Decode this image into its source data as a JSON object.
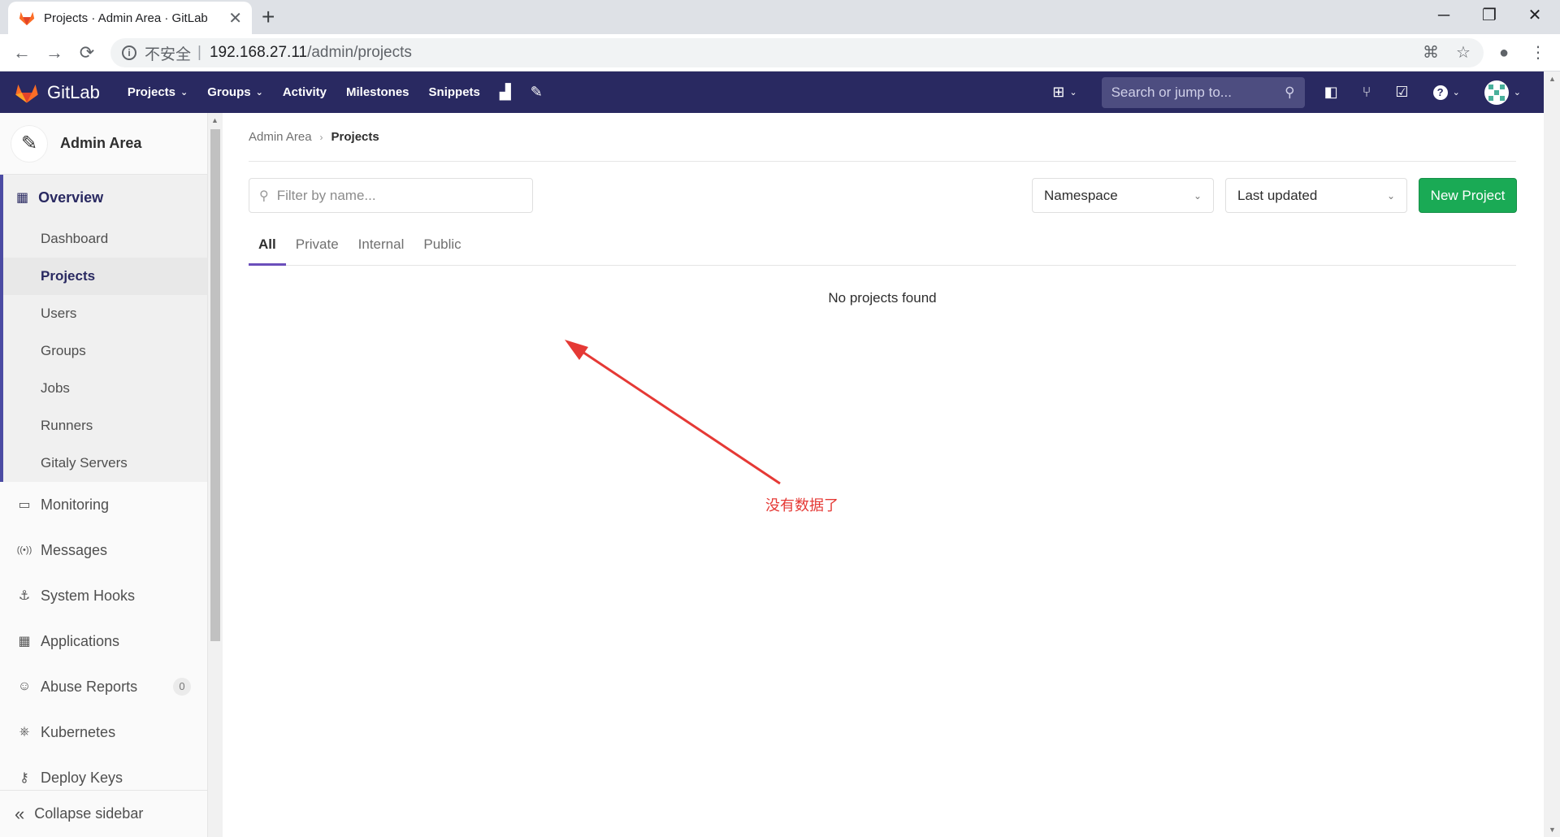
{
  "browser": {
    "tab_title": "Projects · Admin Area · GitLab",
    "tab_close": "✕",
    "new_tab": "+",
    "window_controls": {
      "minimize": "─",
      "maximize": "❐",
      "close": "✕"
    },
    "nav": {
      "back": "←",
      "forward": "→",
      "reload": "⟳"
    },
    "url_info": "i",
    "url_insecure": "不安全",
    "url_separator": "|",
    "url_host": "192.168.27.11",
    "url_path": "/admin/projects",
    "icons": {
      "translate": "⌘",
      "star": "☆",
      "profile": "●",
      "menu": "⋮"
    }
  },
  "header": {
    "brand": "GitLab",
    "nav": [
      {
        "label": "Projects",
        "caret": "⌄"
      },
      {
        "label": "Groups",
        "caret": "⌄"
      },
      {
        "label": "Activity"
      },
      {
        "label": "Milestones"
      },
      {
        "label": "Snippets"
      }
    ],
    "chart_icon": "▟",
    "admin_icon": "✎",
    "plus_icon": "⊞",
    "caret": "⌄",
    "search_placeholder": "Search or jump to...",
    "search_icon": "⚲",
    "issues_icon": "◧",
    "mr_icon": "⑂",
    "todo_icon": "☑",
    "help_icon": "?",
    "colors": {
      "header_bg": "#292961",
      "accent": "#6b4fbb",
      "success": "#1aaa55"
    }
  },
  "sidebar": {
    "context_title": "Admin Area",
    "context_icon": "✎",
    "overview": {
      "label": "Overview",
      "icon": "▦"
    },
    "overview_items": [
      {
        "label": "Dashboard",
        "active": false
      },
      {
        "label": "Projects",
        "active": true
      },
      {
        "label": "Users",
        "active": false
      },
      {
        "label": "Groups",
        "active": false
      },
      {
        "label": "Jobs",
        "active": false
      },
      {
        "label": "Runners",
        "active": false
      },
      {
        "label": "Gitaly Servers",
        "active": false
      }
    ],
    "items": [
      {
        "label": "Monitoring",
        "icon": "▭"
      },
      {
        "label": "Messages",
        "icon": "((•))"
      },
      {
        "label": "System Hooks",
        "icon": "⚓"
      },
      {
        "label": "Applications",
        "icon": "▦"
      },
      {
        "label": "Abuse Reports",
        "icon": "☺",
        "badge": "0"
      },
      {
        "label": "Kubernetes",
        "icon": "⎈"
      },
      {
        "label": "Deploy Keys",
        "icon": "⚷"
      }
    ],
    "collapse_label": "Collapse sidebar",
    "collapse_icon": "«"
  },
  "main": {
    "breadcrumb": {
      "parent": "Admin Area",
      "separator": "›",
      "current": "Projects"
    },
    "filter": {
      "placeholder": "Filter by name...",
      "icon": "⚲"
    },
    "namespace_dropdown": {
      "value": "Namespace",
      "caret": "⌄"
    },
    "sort_dropdown": {
      "value": "Last updated",
      "caret": "⌄"
    },
    "new_project_label": "New Project",
    "tabs": [
      {
        "label": "All",
        "active": true
      },
      {
        "label": "Private",
        "active": false
      },
      {
        "label": "Internal",
        "active": false
      },
      {
        "label": "Public",
        "active": false
      }
    ],
    "empty_message": "No projects found"
  },
  "annotation": {
    "text": "没有数据了",
    "color": "#e53935"
  }
}
